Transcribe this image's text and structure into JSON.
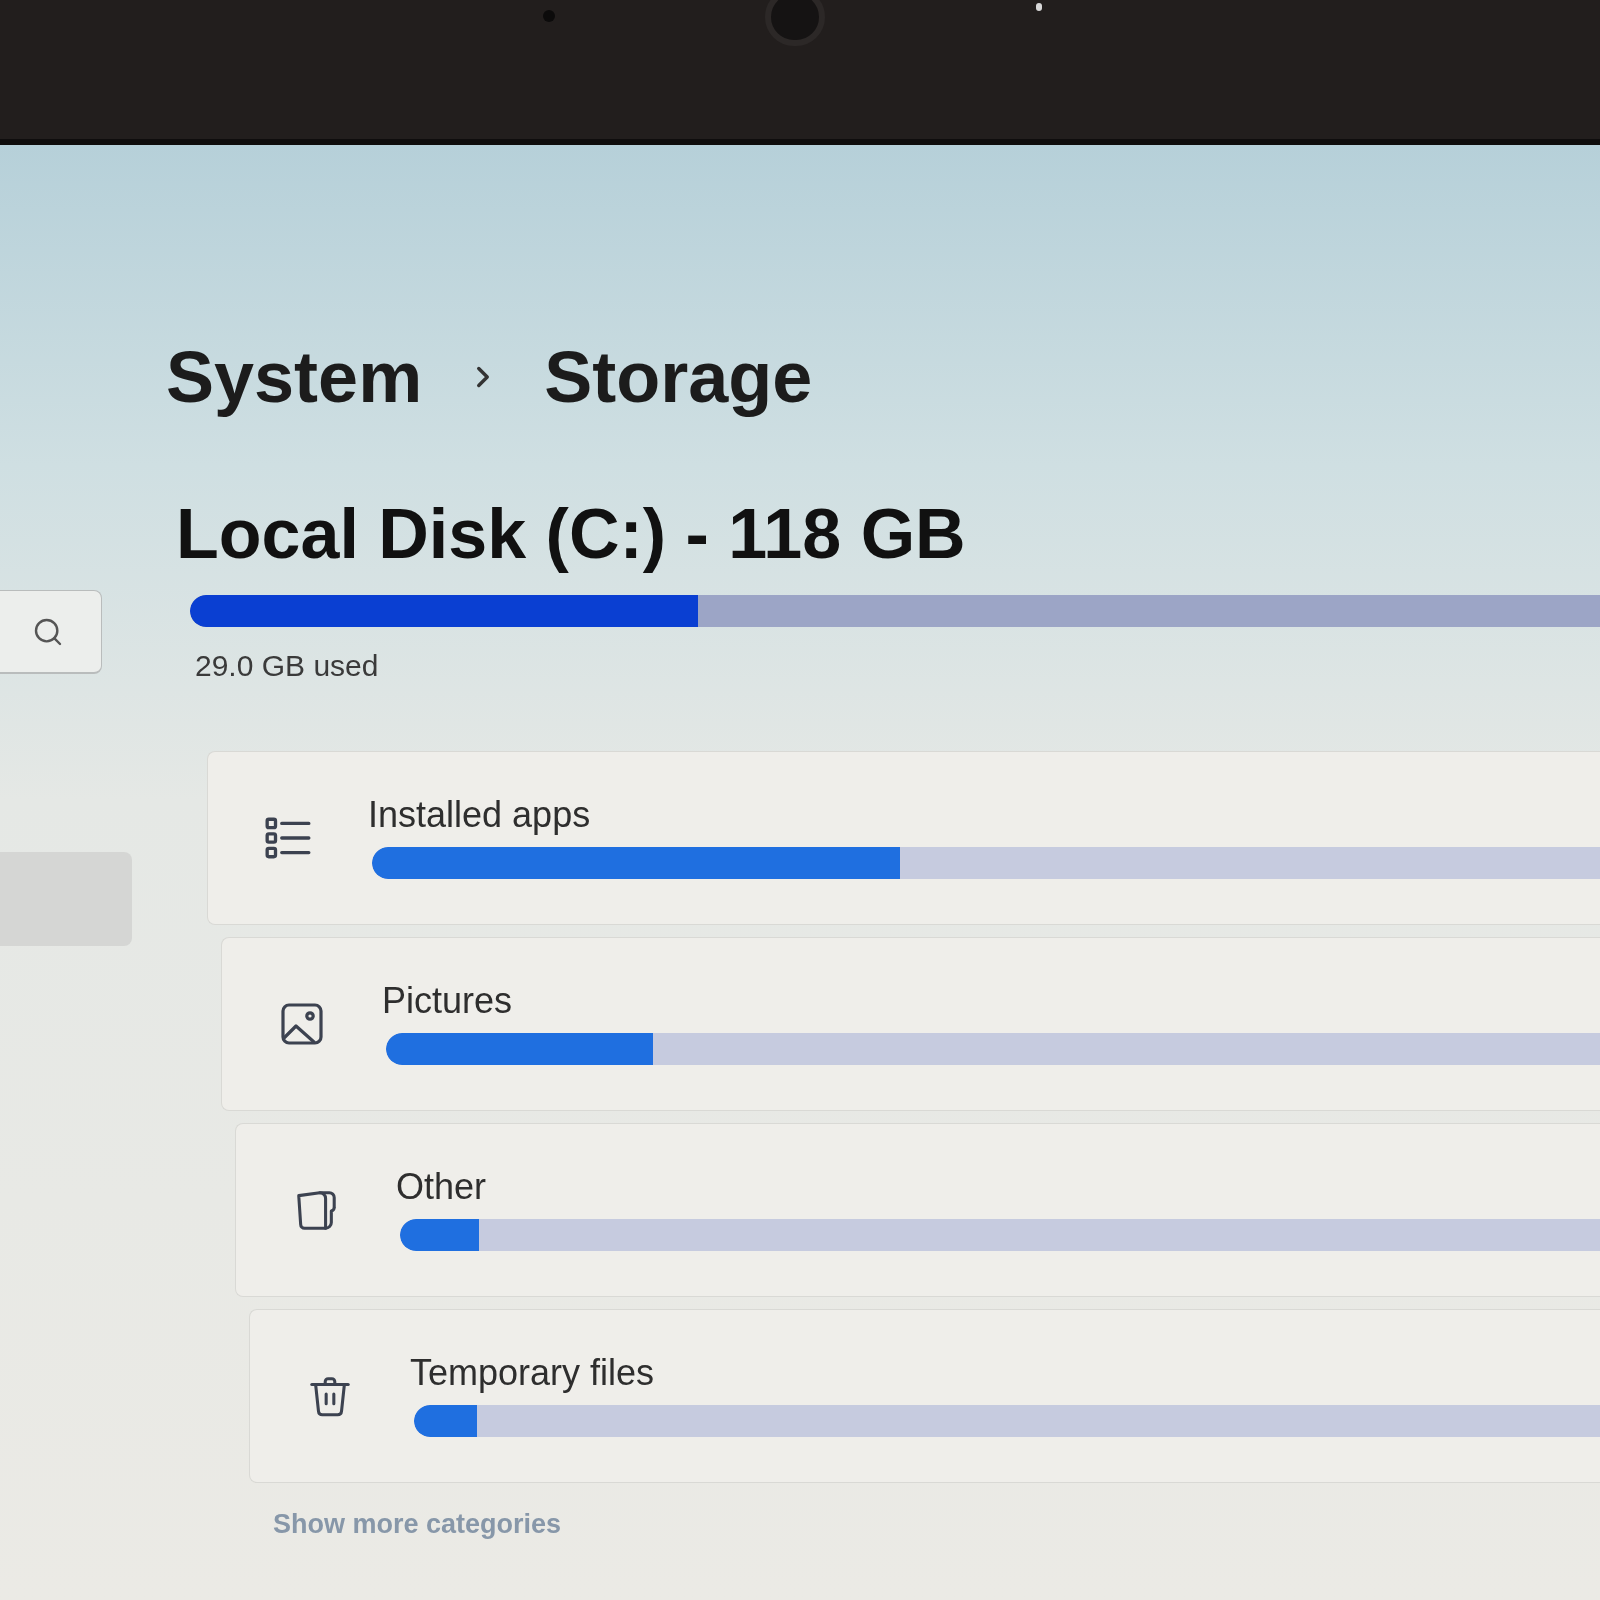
{
  "sidebar": {
    "items": [
      {
        "selected": true
      }
    ]
  },
  "breadcrumb": {
    "parent": "System",
    "current": "Storage"
  },
  "disk": {
    "name": "Local Disk (C:) - 118 GB",
    "level": 0.36,
    "reading": "29.0 GB used"
  },
  "categories": [
    {
      "kind": "apps",
      "name": "Installed apps",
      "level": 0.43
    },
    {
      "kind": "pictures",
      "name": "Pictures",
      "level": 0.22
    },
    {
      "kind": "other",
      "name": "Other",
      "level": 0.066
    },
    {
      "kind": "temp",
      "name": "Temporary files",
      "level": 0.053
    }
  ],
  "more_link": "Show more categories"
}
